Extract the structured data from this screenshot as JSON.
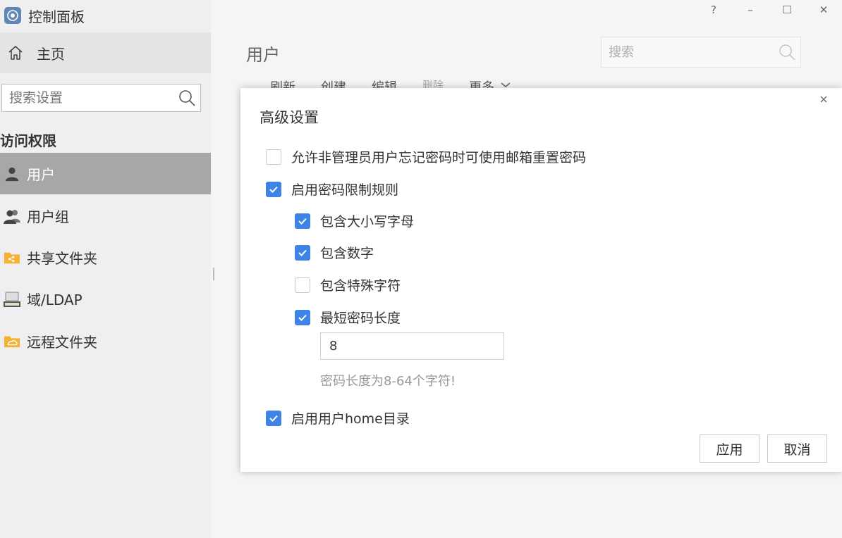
{
  "app": {
    "title": "控制面板"
  },
  "sidebar": {
    "home_label": "主页",
    "search_placeholder": "搜索设置",
    "section_title": "访问权限",
    "items": [
      {
        "label": "用户",
        "icon": "user-icon",
        "active": true
      },
      {
        "label": "用户组",
        "icon": "user-group-icon",
        "active": false
      },
      {
        "label": "共享文件夹",
        "icon": "shared-folder-icon",
        "active": false
      },
      {
        "label": "域/LDAP",
        "icon": "ldap-icon",
        "active": false
      },
      {
        "label": "远程文件夹",
        "icon": "remote-folder-icon",
        "active": false
      }
    ]
  },
  "window_controls": {
    "help": "?",
    "minimize": "–",
    "maximize": "☐",
    "close": "✕"
  },
  "main": {
    "title": "用户",
    "search_placeholder": "搜索",
    "toolbar": [
      "刷新",
      "创建",
      "编辑",
      "删除",
      "更多"
    ]
  },
  "modal": {
    "title": "高级设置",
    "options": [
      {
        "label": "允许非管理员用户忘记密码时可使用邮箱重置密码",
        "checked": false
      },
      {
        "label": "启用密码限制规则",
        "checked": true
      },
      {
        "label": "包含大小写字母",
        "checked": true
      },
      {
        "label": "包含数字",
        "checked": true
      },
      {
        "label": "包含特殊字符",
        "checked": false
      },
      {
        "label": "最短密码长度",
        "checked": true
      },
      {
        "label": "启用用户home目录",
        "checked": true
      }
    ],
    "min_length_value": "8",
    "min_length_hint": "密码长度为8-64个字符!",
    "apply_label": "应用",
    "cancel_label": "取消"
  },
  "colors": {
    "accent": "#3d84e6",
    "sidebar_active": "#a7a7a9",
    "folder": "#f5b335"
  }
}
